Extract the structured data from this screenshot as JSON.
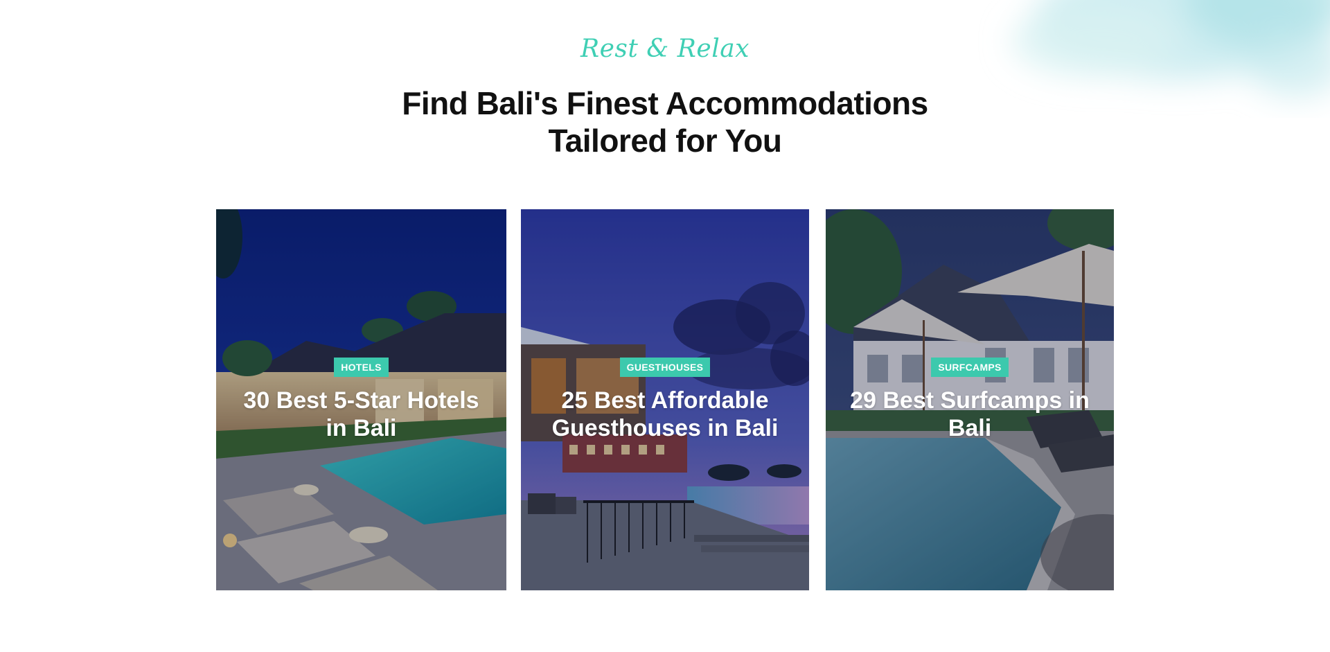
{
  "header": {
    "tagline": "Rest & Relax",
    "heading_line1": "Find Bali's Finest Accommodations",
    "heading_line2": "Tailored for You"
  },
  "colors": {
    "accent": "#3cc9ad",
    "heading": "#111111",
    "background": "#ffffff"
  },
  "cards": [
    {
      "badge": "HOTELS",
      "title": "30 Best 5-Star Hotels in Bali",
      "image": "night-villa-pool-image"
    },
    {
      "badge": "GUESTHOUSES",
      "title": "25 Best Affordable Guesthouses in Bali",
      "image": "dusk-guesthouse-terrace-image"
    },
    {
      "badge": "SURFCAMPS",
      "title": "29 Best Surfcamps in Bali",
      "image": "surfcamp-pool-umbrellas-image"
    }
  ]
}
